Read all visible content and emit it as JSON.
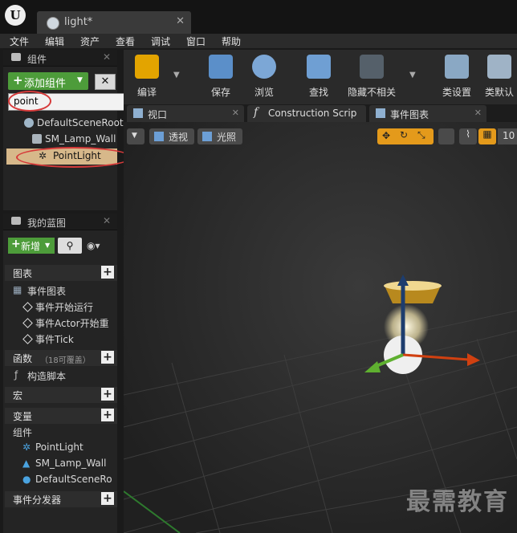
{
  "window": {
    "tab_title": "light*"
  },
  "menu": [
    "文件",
    "编辑",
    "资产",
    "查看",
    "调试",
    "窗口",
    "帮助"
  ],
  "components_panel": {
    "title": "组件",
    "add_button": "添加组件",
    "search_value": "point",
    "tree": [
      "DefaultSceneRoot",
      "SM_Lamp_Wall",
      "PointLight"
    ]
  },
  "blueprint_panel": {
    "title": "我的蓝图",
    "new_button": "新增",
    "sections": {
      "graphs": "图表",
      "event_graph": "事件图表",
      "events": [
        "事件开始运行",
        "事件Actor开始重",
        "事件Tick"
      ],
      "functions": "函数",
      "functions_note": "（18可覆盖）",
      "construction_script": "构造脚本",
      "macros": "宏",
      "variables": "变量",
      "components": "组件",
      "component_items": [
        "PointLight",
        "SM_Lamp_Wall",
        "DefaultSceneRo"
      ],
      "event_dispatchers": "事件分发器"
    }
  },
  "toolbar": [
    "编译",
    "保存",
    "浏览",
    "查找",
    "隐藏不相关",
    "类设置",
    "类默认"
  ],
  "viewport_tabs": [
    "视口",
    "Construction Scrip",
    "事件图表"
  ],
  "viewport": {
    "perspective": "透视",
    "lit": "光照",
    "grid_value": "10"
  },
  "watermark": "最需教育",
  "colors": {
    "accent_green": "#4d9c3a",
    "annotation_red": "#d63a3a",
    "selected_row": "#d7b88a"
  }
}
